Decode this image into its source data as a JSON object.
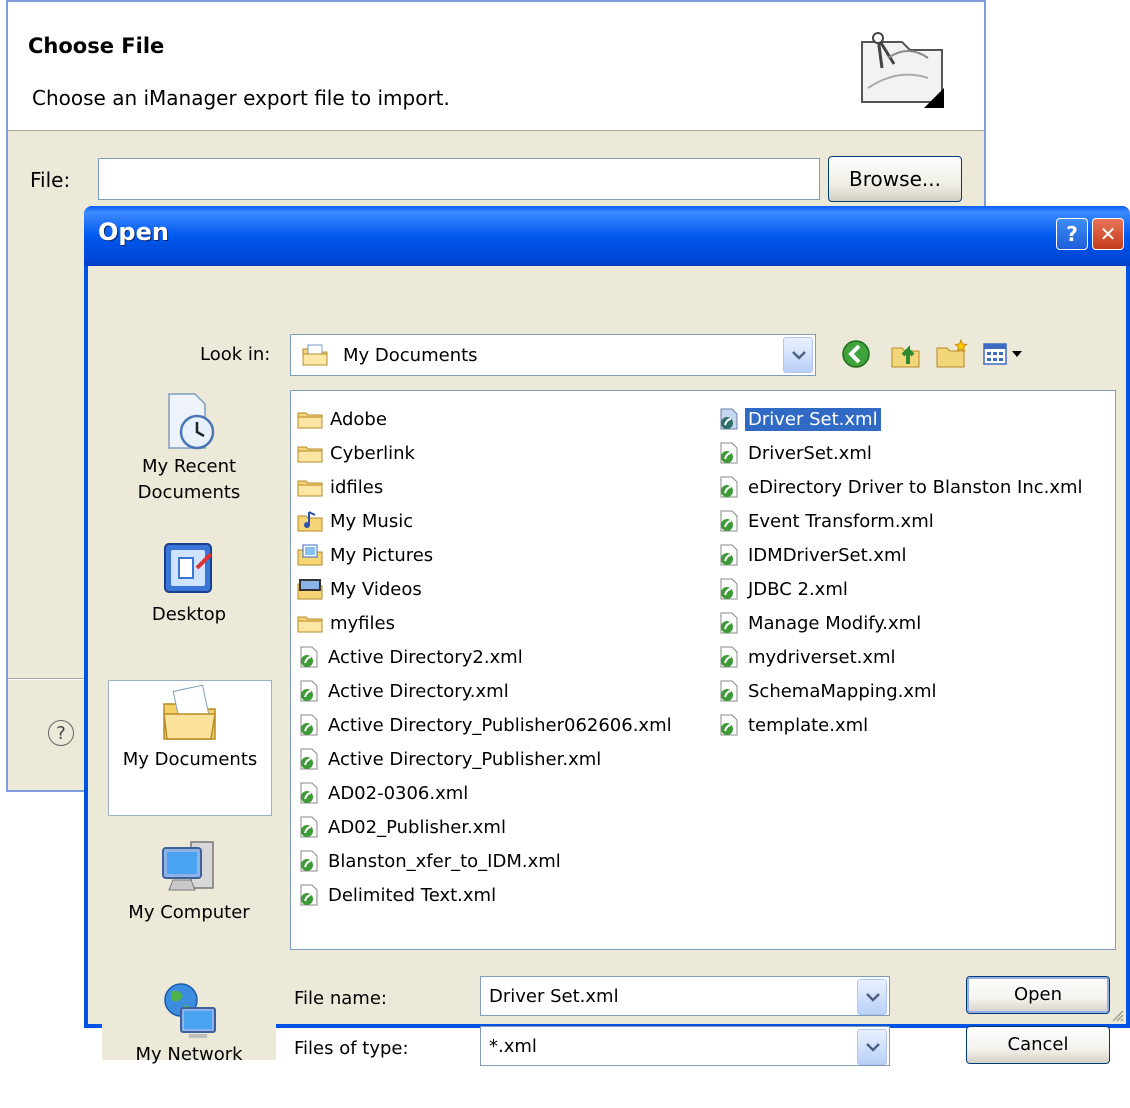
{
  "wizard": {
    "title": "Choose File",
    "description": "Choose an iManager export file to import.",
    "file_label": "File:",
    "file_value": "",
    "browse_label": "Browse...",
    "help_glyph": "?"
  },
  "dialog": {
    "title": "Open",
    "help_glyph": "?",
    "close_glyph": "✕",
    "look_in_label": "Look in:",
    "look_in_value": "My Documents",
    "toolbar_icons": [
      "back-icon",
      "up-folder-icon",
      "new-folder-icon",
      "views-menu-icon"
    ],
    "places": [
      {
        "label_lines": [
          "My Recent",
          "Documents"
        ],
        "icon": "recent-documents-icon"
      },
      {
        "label_lines": [
          "Desktop"
        ],
        "icon": "desktop-icon"
      },
      {
        "label_lines": [
          "My Documents"
        ],
        "icon": "my-documents-icon",
        "selected": true
      },
      {
        "label_lines": [
          "My Computer"
        ],
        "icon": "my-computer-icon"
      },
      {
        "label_lines": [
          "My Network"
        ],
        "icon": "my-network-icon"
      }
    ],
    "files_col1": [
      {
        "name": "Adobe",
        "kind": "folder"
      },
      {
        "name": "Cyberlink",
        "kind": "folder"
      },
      {
        "name": "idfiles",
        "kind": "folder"
      },
      {
        "name": "My Music",
        "kind": "music-folder"
      },
      {
        "name": "My Pictures",
        "kind": "pictures-folder"
      },
      {
        "name": "My Videos",
        "kind": "videos-folder"
      },
      {
        "name": "myfiles",
        "kind": "folder"
      },
      {
        "name": "Active Directory2.xml",
        "kind": "xml"
      },
      {
        "name": "Active Directory.xml",
        "kind": "xml"
      },
      {
        "name": "Active Directory_Publisher062606.xml",
        "kind": "xml"
      },
      {
        "name": "Active Directory_Publisher.xml",
        "kind": "xml"
      },
      {
        "name": "AD02-0306.xml",
        "kind": "xml"
      },
      {
        "name": "AD02_Publisher.xml",
        "kind": "xml"
      },
      {
        "name": "Blanston_xfer_to_IDM.xml",
        "kind": "xml"
      },
      {
        "name": "Delimited Text.xml",
        "kind": "xml"
      }
    ],
    "files_col2": [
      {
        "name": "Driver Set.xml",
        "kind": "xml",
        "selected": true
      },
      {
        "name": "DriverSet.xml",
        "kind": "xml"
      },
      {
        "name": "eDirectory Driver to Blanston Inc.xml",
        "kind": "xml"
      },
      {
        "name": "Event Transform.xml",
        "kind": "xml"
      },
      {
        "name": "IDMDriverSet.xml",
        "kind": "xml"
      },
      {
        "name": "JDBC 2.xml",
        "kind": "xml"
      },
      {
        "name": "Manage Modify.xml",
        "kind": "xml"
      },
      {
        "name": "mydriverset.xml",
        "kind": "xml"
      },
      {
        "name": "SchemaMapping.xml",
        "kind": "xml"
      },
      {
        "name": "template.xml",
        "kind": "xml"
      }
    ],
    "file_name_label": "File name:",
    "file_name_value": "Driver Set.xml",
    "files_of_type_label": "Files of type:",
    "files_of_type_value": "*.xml",
    "open_label": "Open",
    "cancel_label": "Cancel"
  }
}
